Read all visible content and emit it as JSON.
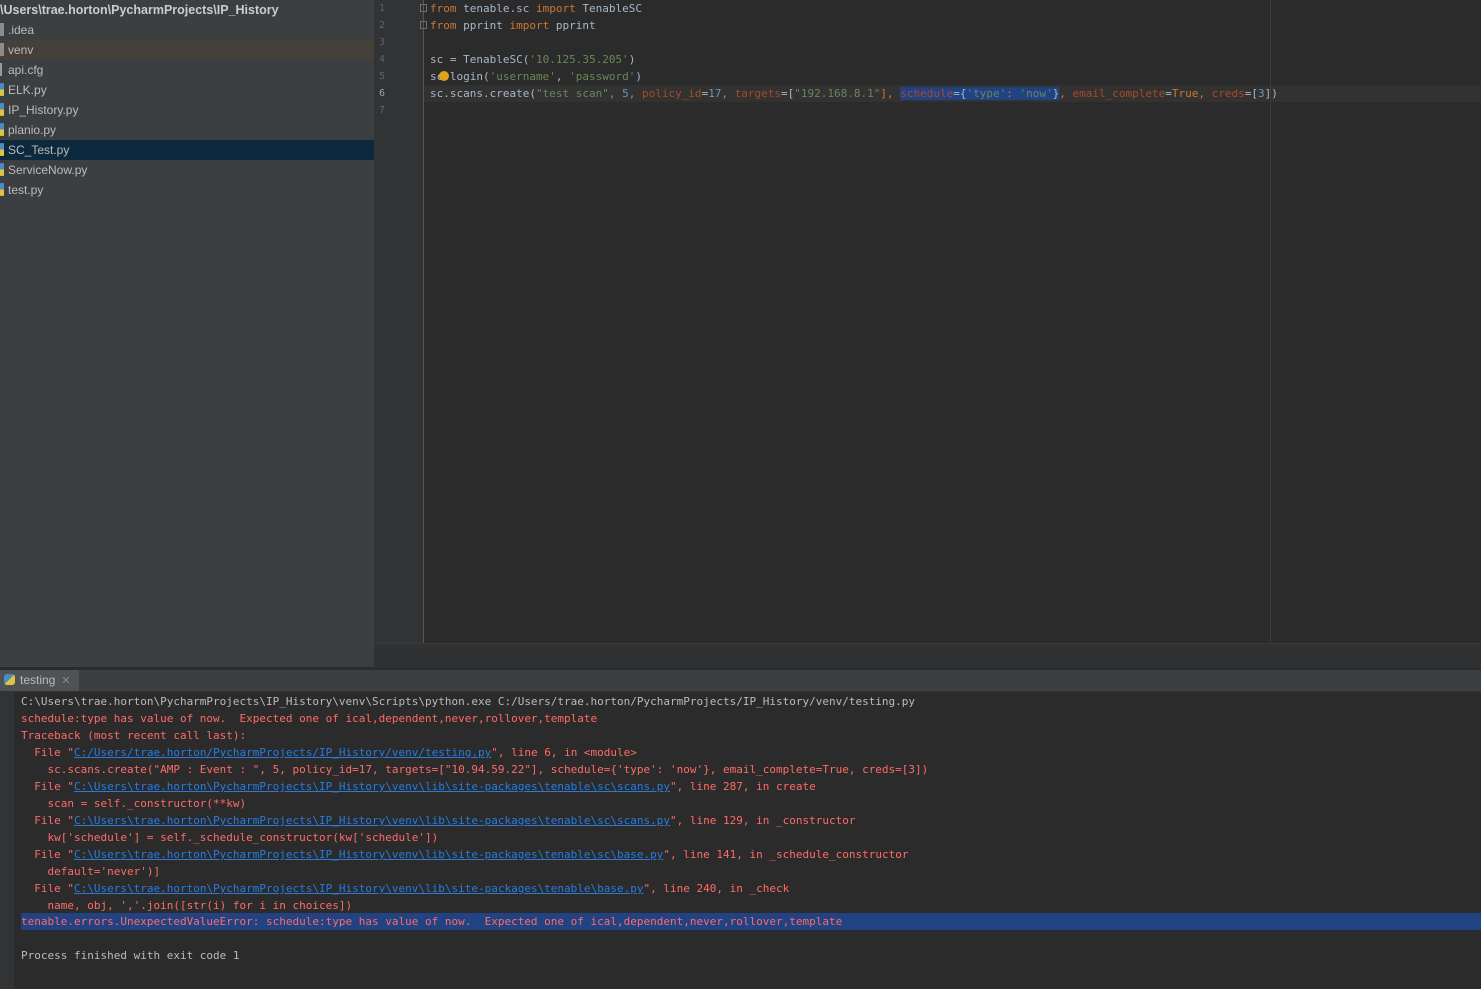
{
  "project": {
    "root_label": "\\Users\\trae.horton\\PycharmProjects\\IP_History",
    "items": [
      {
        "label": ".idea",
        "kind": "folder"
      },
      {
        "label": "venv",
        "kind": "folder"
      },
      {
        "label": "api.cfg",
        "kind": "file"
      },
      {
        "label": "ELK.py",
        "kind": "python"
      },
      {
        "label": "IP_History.py",
        "kind": "python"
      },
      {
        "label": "planio.py",
        "kind": "python"
      },
      {
        "label": "SC_Test.py",
        "kind": "python"
      },
      {
        "label": "ServiceNow.py",
        "kind": "python"
      },
      {
        "label": "test.py",
        "kind": "python"
      }
    ]
  },
  "editor": {
    "line_numbers": [
      "1",
      "2",
      "3",
      "4",
      "5",
      "6",
      "7"
    ],
    "current_line": "6",
    "lines": {
      "l1": {
        "t1": "from",
        "t2": " tenable.sc ",
        "t3": "import",
        "t4": " TenableSC"
      },
      "l2": {
        "t1": "from",
        "t2": " pprint ",
        "t3": "import",
        "t4": " pprint"
      },
      "l4": {
        "t1": "sc = TenableSC(",
        "t2": "'10.125.35.205'",
        "t3": ")"
      },
      "l5": {
        "t1": "s",
        "t2": "c.login(",
        "t3": "'username'",
        "t4": ", ",
        "t5": "'password'",
        "t6": ")"
      },
      "l6": {
        "t1": "sc.scans.create(",
        "t2": "\"test scan\"",
        "t3": ", ",
        "t4": "5",
        "t5": ", ",
        "t6": "policy_id",
        "t7": "=",
        "t8": "17",
        "t9": ", ",
        "t10": "targets",
        "t11": "=[",
        "t12": "\"192.168.8.1\"",
        "t13": "], ",
        "t14": "schedule",
        "t15": "={",
        "t16": "'type'",
        "t17": ": ",
        "t18": "'now'",
        "t19": "}",
        "t20": ", ",
        "t21": "email_complete",
        "t22": "=",
        "t23": "True",
        "t24": ", ",
        "t25": "creds",
        "t26": "=[",
        "t27": "3",
        "t28": "])"
      }
    }
  },
  "run": {
    "tab_label": "testing",
    "console": {
      "cmd": "C:\\Users\\trae.horton\\PycharmProjects\\IP_History\\venv\\Scripts\\python.exe C:/Users/trae.horton/PycharmProjects/IP_History/venv/testing.py",
      "err1": "schedule:type has value of now.  Expected one of ical,dependent,never,rollover,template",
      "tb": "Traceback (most recent call last):",
      "f1_pre": "  File \"",
      "f1_link": "C:/Users/trae.horton/PycharmProjects/IP_History/venv/testing.py",
      "f1_post": "\", line 6, in <module>",
      "f1_code": "    sc.scans.create(\"AMP : Event : \", 5, policy_id=17, targets=[\"10.94.59.22\"], schedule={'type': 'now'}, email_complete=True, creds=[3])",
      "f2_pre": "  File \"",
      "f2_link": "C:\\Users\\trae.horton\\PycharmProjects\\IP_History\\venv\\lib\\site-packages\\tenable\\sc\\scans.py",
      "f2_post": "\", line 287, in create",
      "f2_code": "    scan = self._constructor(**kw)",
      "f3_pre": "  File \"",
      "f3_link": "C:\\Users\\trae.horton\\PycharmProjects\\IP_History\\venv\\lib\\site-packages\\tenable\\sc\\scans.py",
      "f3_post": "\", line 129, in _constructor",
      "f3_code": "    kw['schedule'] = self._schedule_constructor(kw['schedule'])",
      "f4_pre": "  File \"",
      "f4_link": "C:\\Users\\trae.horton\\PycharmProjects\\IP_History\\venv\\lib\\site-packages\\tenable\\sc\\base.py",
      "f4_post": "\", line 141, in _schedule_constructor",
      "f4_code": "    default='never')]",
      "f5_pre": "  File \"",
      "f5_link": "C:\\Users\\trae.horton\\PycharmProjects\\IP_History\\venv\\lib\\site-packages\\tenable\\base.py",
      "f5_post": "\", line 240, in _check",
      "f5_code": "    name, obj, ','.join([str(i) for i in choices])",
      "final_err": "tenable.errors.UnexpectedValueError: schedule:type has value of now.  Expected one of ical,dependent,never,rollover,template",
      "exit": "Process finished with exit code 1"
    }
  },
  "colors": {
    "keyword": "#cc7832",
    "string": "#6a8759",
    "number": "#6897bb",
    "param": "#aa4926",
    "error": "#ff6b68",
    "link": "#287bde",
    "selection": "#214283"
  },
  "icons": [
    "folder-icon",
    "file-icon",
    "python-file-icon",
    "fold-marker-icon",
    "intention-bulb-icon",
    "python-run-icon",
    "close-icon"
  ]
}
